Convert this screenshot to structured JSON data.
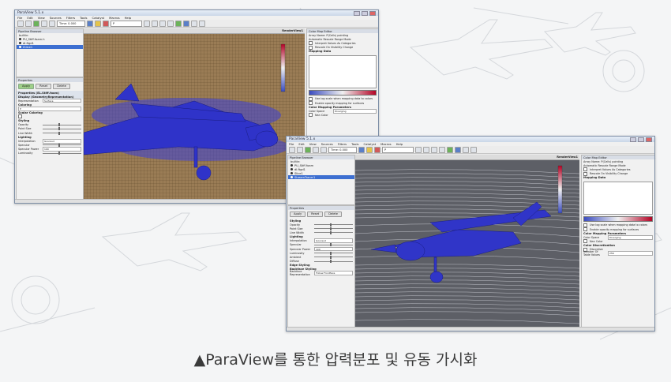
{
  "caption": "▲ParaView를 통한 압력분포 및 유동 가시화",
  "windows": [
    {
      "title": "ParaView 5.1.x",
      "menu": [
        "File",
        "Edit",
        "View",
        "Sources",
        "Filters",
        "Tools",
        "Catalyst",
        "Macros",
        "Help"
      ],
      "toolbar": {
        "time_label": "Time: 0.000",
        "field": "P"
      },
      "pipeline_header": "Pipeline Browser",
      "pipeline_items": [
        "builtin:",
        "PU_Stiff.foam.h",
        "dI.ftgd1",
        "tSlice1"
      ],
      "properties_header": "Properties",
      "apply_label": "Apply",
      "reset_label": "Reset",
      "delete_label": "Delete",
      "sections": [
        "Properties (EL.Stiff.foam)",
        "Display (GeometryRepresentation)",
        "Coloring",
        "Scalar Coloring",
        "Styling",
        "Lighting"
      ],
      "rows": [
        {
          "label": "Representation",
          "value": "Surface"
        },
        {
          "label": "Opacity",
          "value": ""
        },
        {
          "label": "Point Size",
          "value": ""
        },
        {
          "label": "Line Width",
          "value": ""
        },
        {
          "label": "Interpolation",
          "value": "Gouraud"
        },
        {
          "label": "Specular",
          "value": ""
        },
        {
          "label": "Specular Power",
          "value": "100"
        },
        {
          "label": "Luminosity",
          "value": ""
        }
      ],
      "view_label": "RenderView1",
      "colormap_header": "Color Map Editor",
      "colormap_rows": [
        "Array Name: P(Cells) pointing",
        "Automatic Rescale Range Mode",
        "Interpret Values As Categories",
        "Rescale On Visibility Change",
        "Mapping Data",
        "Use log scale when mapping data to colors",
        "Enable opacity mapping for surfaces",
        "Color Mapping Parameters",
        "Color Space",
        "Diverging",
        "Nan Color"
      ]
    },
    {
      "title": "ParaView 5.1.x",
      "menu": [
        "File",
        "Edit",
        "View",
        "Sources",
        "Filters",
        "Tools",
        "Catalyst",
        "Macros",
        "Help"
      ],
      "toolbar": {
        "time_label": "Time: 0.000",
        "field": "P"
      },
      "pipeline_header": "Pipeline Browser",
      "pipeline_items": [
        "builtin:",
        "PU_Stiff.foam",
        "dI.ftgd1",
        "Slice1",
        "StreamTracer1"
      ],
      "properties_header": "Properties",
      "apply_label": "Apply",
      "reset_label": "Reset",
      "delete_label": "Delete",
      "sections": [
        "Styling",
        "Lighting",
        "Edge Styling",
        "Backface Styling"
      ],
      "rows": [
        {
          "label": "Opacity",
          "value": ""
        },
        {
          "label": "Point Size",
          "value": ""
        },
        {
          "label": "Line Width",
          "value": ""
        },
        {
          "label": "Interpolation",
          "value": "Gouraud"
        },
        {
          "label": "Specular",
          "value": ""
        },
        {
          "label": "Specular Power",
          "value": "100"
        },
        {
          "label": "Luminosity",
          "value": ""
        },
        {
          "label": "Ambient",
          "value": ""
        },
        {
          "label": "Diffuse",
          "value": ""
        },
        {
          "label": "Backface Representation",
          "value": "Follow Frontface"
        }
      ],
      "view_label": "RenderView1",
      "colormap_header": "Color Map Editor",
      "colormap_rows": [
        "Array Name: P(Cells) pointing",
        "Automatic Rescale Range Mode",
        "Interpret Values As Categories",
        "Rescale On Visibility Change",
        "Mapping Data",
        "Use log scale when mapping data to colors",
        "Enable opacity mapping for surfaces",
        "Color Mapping Parameters",
        "Color Space",
        "Diverging",
        "Nan Color",
        "Color Discretization",
        "Discretize",
        "Number Of Table Values",
        "256"
      ]
    }
  ]
}
